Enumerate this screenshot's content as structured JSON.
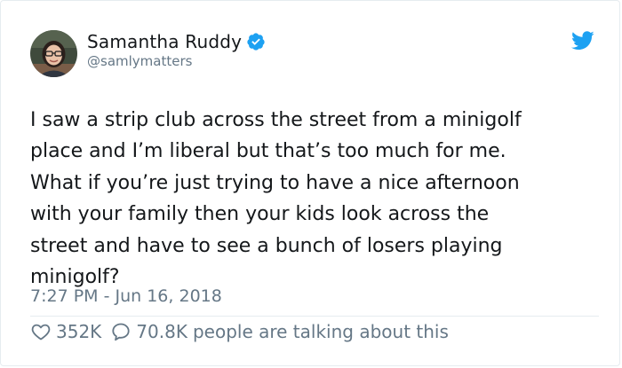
{
  "author": {
    "display_name": "Samantha Ruddy",
    "handle": "@samlymatters",
    "verified": true,
    "avatar_icon": "profile-photo"
  },
  "brand": {
    "icon": "twitter-bird-icon",
    "color": "#1da1f2"
  },
  "tweet": {
    "text": "I saw a strip club across the street from a minigolf\nplace and I’m liberal but that’s too much for me.\nWhat if you’re just trying to have a nice afternoon\nwith your family then your kids look across the\nstreet and have to see a bunch of losers playing\nminigolf?",
    "timestamp": "7:27 PM - Jun 16, 2018"
  },
  "engagement": {
    "likes": "352K",
    "replies": "70.8K",
    "talking_label": "people are talking about this",
    "like_icon": "heart-icon",
    "reply_icon": "speech-bubble-icon"
  },
  "colors": {
    "text_primary": "#14171a",
    "text_secondary": "#657786",
    "border": "#e6ecf0",
    "verified_blue": "#1da1f2"
  }
}
